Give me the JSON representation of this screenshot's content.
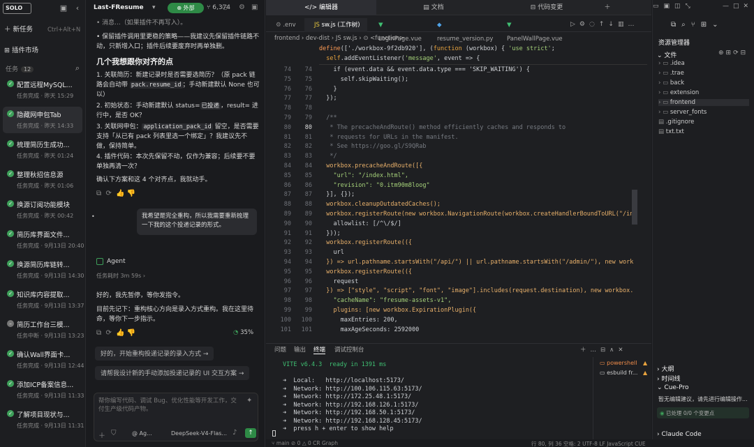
{
  "sidebar": {
    "brand": "SOLO",
    "new_task": "新任务",
    "new_task_shortcut": "Ctrl+Alt+N",
    "plugin_market": "插件市场",
    "tasks_label": "任务",
    "tasks_count": "12",
    "tasks": [
      {
        "title": "配置远程MySQL...",
        "sub": "任务完成 · 昨天 15:29",
        "status": "done"
      },
      {
        "title": "隐藏网申包Tab",
        "sub": "任务完成 · 昨天 14:33",
        "status": "done"
      },
      {
        "title": "梳理简历生成功...",
        "sub": "任务完成 · 昨天 01:24",
        "status": "done"
      },
      {
        "title": "整理秋招信息源",
        "sub": "任务完成 · 昨天 01:06",
        "status": "done"
      },
      {
        "title": "换源订阅功能模块",
        "sub": "任务完成 · 昨天 00:42",
        "status": "done"
      },
      {
        "title": "简历库界面文件...",
        "sub": "任务完成 · 9月13日 20:40",
        "status": "done"
      },
      {
        "title": "换源简历库链转...",
        "sub": "任务完成 · 9月13日 14:30",
        "status": "done"
      },
      {
        "title": "知识库内容提取...",
        "sub": "任务完成 · 9月13日 13:37",
        "status": "done"
      },
      {
        "title": "简历工作台三模...",
        "sub": "任务中断 · 9月13日 13:23",
        "status": "stopped"
      },
      {
        "title": "确认Wall界面卡...",
        "sub": "任务完成 · 9月13日 12:44",
        "status": "done"
      },
      {
        "title": "添加ICP备案信息...",
        "sub": "任务完成 · 9月13日 11:33",
        "status": "done"
      },
      {
        "title": "了解项目现状与...",
        "sub": "任务完成 · 9月13日 11:31",
        "status": "done"
      }
    ]
  },
  "chat": {
    "title": "Last-FResume",
    "pill": "⊕ 外部",
    "stars": "6,374",
    "bullet1": "保留插件调用里更稳的策略——我建议先保留插件链路不动，只新增入口；插件后续要废弃时再单独删。",
    "heading": "几个我想跟你对齐的点",
    "items": [
      {
        "n": "1.",
        "pre": "关联简历：新建记录时是否需要选简历？（原 pack 链路会自动带 ",
        "code": "pack.resume_id",
        "post": "；手动新建默认 None 也可以）"
      },
      {
        "n": "2.",
        "pre": "初始状态：手动新建默认 status=",
        "code": "已投递",
        "post": "，result= 进行中，是否 OK？"
      },
      {
        "n": "3.",
        "pre": "关联网申包：",
        "code": "application_pack_id",
        "post": " 留空，是否需要支持「从已有 pack 列表里选一个绑定」？我建议先不做，保持简单。"
      },
      {
        "n": "4.",
        "pre": "插件代码：本次先保留不动，仅作为兼容；后续要不要单独再清一次？",
        "code": "",
        "post": ""
      }
    ],
    "confirm": "确认下方案和这 4 个对齐点，我就动手。",
    "user_msg": "我希望是完全重构，所以我需要重新梳理一下我的这个投递记录的形式。",
    "agent_label": "Agent",
    "agent_time": "任务耗时 3m 59s",
    "agent_p1": "好的，我先暂停，等你发指令。",
    "agent_p2": "目前先记下：重构核心方向是录入方式重构。我在这里待命，等你下一步指示。",
    "progress": "35%",
    "sugg1": "好的，开始重构投递记录的录入方式",
    "sugg2": "请帮我设计新的手动添加投递记录的 UI 交互方案",
    "input_placeholder": "帮你编写代码、调试 Bug、优化性能等开发工作，交付生产级代码产物。",
    "agent_select": "@ Ag...",
    "model": "DeepSeek-V4-Flas..."
  },
  "editor": {
    "top_tabs": [
      "编辑器",
      "文档",
      "代码变更"
    ],
    "file_tabs": [
      ".env",
      "sw.js (工作树)",
      "LoginPage.vue",
      "resume_version.py",
      "PanelWallPage.vue"
    ],
    "breadcrumb": "frontend › dev-dist › JS sw.js › ⊙ <function>",
    "pinned_line": "define(['./workbox-9f2db920'], (function (workbox) { 'use strict';",
    "pinned_line2": "  self.addEventListener('message', event => {",
    "lines": [
      {
        "n": "74",
        "t": "    if (event.data && event.data.type === 'SKIP_WAITING') {"
      },
      {
        "n": "75",
        "t": "      self.skipWaiting();"
      },
      {
        "n": "76",
        "t": "    }"
      },
      {
        "n": "77",
        "t": "  });"
      },
      {
        "n": "78",
        "t": ""
      },
      {
        "n": "79",
        "t": "  /**"
      },
      {
        "n": "80",
        "t": "   * The precacheAndRoute() method efficiently caches and responds to"
      },
      {
        "n": "81",
        "t": "   * requests for URLs in the manifest."
      },
      {
        "n": "82",
        "t": "   * See https://goo.gl/S9QRab"
      },
      {
        "n": "83",
        "t": "   */"
      },
      {
        "n": "84",
        "t": "  workbox.precacheAndRoute([{"
      },
      {
        "n": "85",
        "t": "    \"url\": \"/index.html\","
      },
      {
        "n": "86",
        "t": "    \"revision\": \"0.itm90m8loog\""
      },
      {
        "n": "87",
        "t": "  }], {});"
      },
      {
        "n": "88",
        "t": "  workbox.cleanupOutdatedCaches();"
      },
      {
        "n": "89",
        "t": "  workbox.registerRoute(new workbox.NavigationRoute(workbox.createHandlerBoundToURL(\"/index"
      },
      {
        "n": "90",
        "t": "    allowlist: [/^\\/$/]"
      },
      {
        "n": "91",
        "t": "  }));"
      },
      {
        "n": "92",
        "t": "  workbox.registerRoute(({"
      },
      {
        "n": "93",
        "t": "    url"
      },
      {
        "n": "94",
        "t": "  }) => url.pathname.startsWith(\"/api/\") || url.pathname.startsWith(\"/admin/\"), new workbox."
      },
      {
        "n": "95",
        "t": "  workbox.registerRoute(({"
      },
      {
        "n": "96",
        "t": "    request"
      },
      {
        "n": "97",
        "t": "  }) => [\"style\", \"script\", \"font\", \"image\"].includes(request.destination), new workbox.Sta"
      },
      {
        "n": "98",
        "t": "    \"cacheName\": \"fresume-assets-v1\","
      },
      {
        "n": "99",
        "t": "    plugins: [new workbox.ExpirationPlugin({"
      },
      {
        "n": "100",
        "t": "      maxEntries: 200,"
      },
      {
        "n": "101",
        "t": "      maxAgeSeconds: 2592000"
      }
    ],
    "term_tabs": [
      "问题",
      "输出",
      "终端",
      "调试控制台"
    ],
    "term_lines": [
      "VITE v6.4.3  ready in 1391 ms",
      "",
      "➜  Local:   http://localhost:5173/",
      "➜  Network: http://100.106.115.63:5173/",
      "➜  Network: http://172.25.48.1:5173/",
      "➜  Network: http://192.168.126.1:5173/",
      "➜  Network: http://192.168.50.1:5173/",
      "➜  Network: http://192.168.128.45:5173/",
      "➜  press h + enter to show help"
    ],
    "shells": [
      "powershell",
      "esbuild fr..."
    ]
  },
  "explorer": {
    "title": "资源管理器",
    "files_label": "文件",
    "items": [
      ".idea",
      ".trae",
      "back",
      "extension",
      "frontend",
      "server_fonts",
      ".gitignore",
      "txt.txt"
    ],
    "outline": "大纲",
    "timeline": "时间线",
    "cue_pro": "Cue-Pro",
    "cue_text": "暂无编辑建议，请先进行编辑操作...",
    "cue_status": "已处理 0/0 个变更点",
    "claude": "Claude Code"
  },
  "status": {
    "left": "⑂ main  ⊘ 0 △ 0  CR Graph",
    "right": "行 80, 列 36  空格: 2  UTF-8  LF  JavaScript  CUE"
  }
}
